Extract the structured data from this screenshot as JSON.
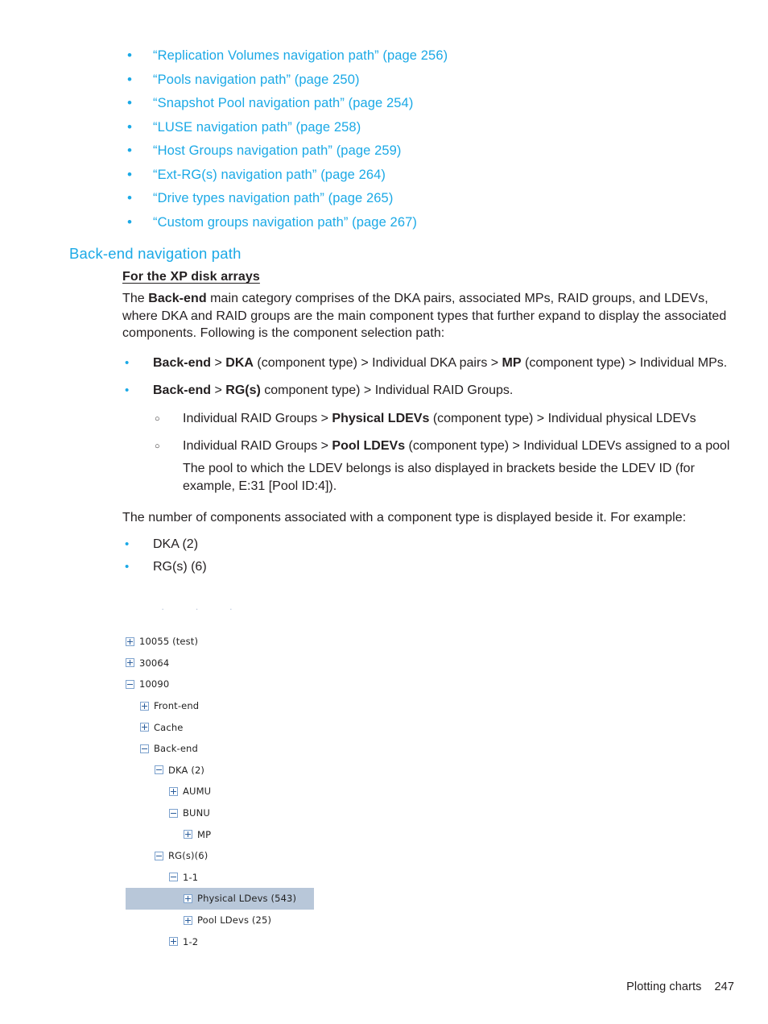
{
  "xref": {
    "bullet": "•",
    "items": [
      {
        "text": "“Replication Volumes navigation path” (page 256)"
      },
      {
        "text": "“Pools navigation path” (page 250)"
      },
      {
        "text": "“Snapshot Pool navigation path” (page 254)"
      },
      {
        "text": "“LUSE navigation path” (page 258)"
      },
      {
        "text": "“Host Groups navigation path” (page 259)"
      },
      {
        "text": "“Ext-RG(s) navigation path” (page 264)"
      },
      {
        "text": "“Drive types navigation path” (page 265)"
      },
      {
        "text": "“Custom groups navigation path” (page 267)"
      }
    ]
  },
  "section": {
    "heading": "Back-end navigation path",
    "sub_heading": "For the XP disk arrays",
    "intro_pre": "The ",
    "intro_bold": "Back-end",
    "intro_post": " main category comprises of the DKA pairs, associated MPs, RAID groups, and LDEVs, where DKA and RAID groups are the main component types that further expand to display the associated components. Following is the component selection path:"
  },
  "paths": {
    "bullet": "•",
    "items": [
      {
        "b1": "Back-end",
        "t1": " > ",
        "b2": "DKA",
        "t2": " (component type) > Individual DKA pairs > ",
        "b3": "MP",
        "t3": " (component type) > Individual MPs."
      },
      {
        "b1": "Back-end",
        "t1": " > ",
        "b2": "RG(s)",
        "t2": " component type) > Individual RAID Groups.",
        "b3": "",
        "t3": ""
      }
    ]
  },
  "subpaths": {
    "bullet": "○",
    "items": [
      {
        "pre": "Individual RAID Groups > ",
        "bold": "Physical LDEVs",
        "post": " (component type) > Individual physical LDEVs"
      },
      {
        "pre": "Individual RAID Groups > ",
        "bold": "Pool LDEVs",
        "post": " (component type) > Individual LDEVs assigned to a pool"
      }
    ],
    "note": "The pool to which the LDEV belongs is also displayed in brackets beside the LDEV ID (for example, E:31 [Pool ID:4])."
  },
  "counts": {
    "intro": "The number of components associated with a component type is displayed beside it. For example:",
    "bullet": "•",
    "items": [
      {
        "text": "DKA (2)"
      },
      {
        "text": "RG(s) (6)"
      }
    ]
  },
  "tree": {
    "artifact": "···",
    "rows": [
      {
        "label": "10055 (test)",
        "level": 0,
        "state": "collapsed",
        "selected": false
      },
      {
        "label": "30064",
        "level": 0,
        "state": "collapsed",
        "selected": false
      },
      {
        "label": "10090",
        "level": 0,
        "state": "expanded",
        "selected": false
      },
      {
        "label": "Front-end",
        "level": 1,
        "state": "collapsed",
        "selected": false
      },
      {
        "label": "Cache",
        "level": 1,
        "state": "collapsed",
        "selected": false
      },
      {
        "label": "Back-end",
        "level": 1,
        "state": "expanded",
        "selected": false
      },
      {
        "label": "DKA (2)",
        "level": 2,
        "state": "expanded",
        "selected": false
      },
      {
        "label": "AUMU",
        "level": 3,
        "state": "collapsed",
        "selected": false
      },
      {
        "label": "BUNU",
        "level": 3,
        "state": "expanded",
        "selected": false
      },
      {
        "label": "MP",
        "level": 4,
        "state": "collapsed",
        "selected": false
      },
      {
        "label": "RG(s)(6)",
        "level": 2,
        "state": "expanded",
        "selected": false
      },
      {
        "label": "1-1",
        "level": 3,
        "state": "expanded",
        "selected": false
      },
      {
        "label": "Physical LDevs (543)",
        "level": 4,
        "state": "collapsed",
        "selected": true
      },
      {
        "label": "Pool LDevs (25)",
        "level": 4,
        "state": "collapsed",
        "selected": false
      },
      {
        "label": "1-2",
        "level": 3,
        "state": "collapsed",
        "selected": false
      }
    ]
  },
  "footer": {
    "chapter": "Plotting charts",
    "page": "247"
  },
  "colors": {
    "link_blue": "#1ba9e6",
    "heading_blue": "#1ba9e6",
    "body_text": "#231f20",
    "tree_selection": "#b8c7d9",
    "expander_border": "#7da2ce",
    "expander_glyph": "#2b5d9b"
  }
}
